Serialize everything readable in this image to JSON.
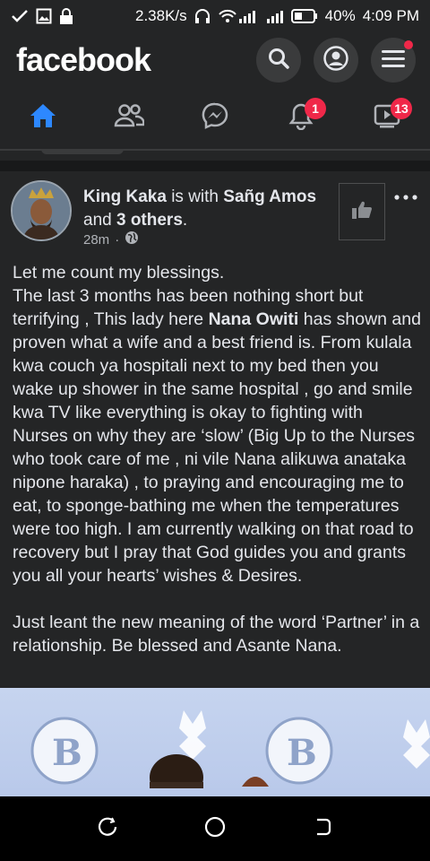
{
  "status_bar": {
    "speed": "2.38K/s",
    "battery": "40%",
    "time": "4:09 PM"
  },
  "header": {
    "brand": "facebook"
  },
  "nav": {
    "notifications_badge": "1",
    "watch_badge": "13",
    "active_tab": "home",
    "accent_color": "#2d88ff"
  },
  "post": {
    "author": "King Kaka",
    "with_text": " is with ",
    "tagged": "Sañg Amos",
    "and_text": "and ",
    "others": "3 others",
    "others_suffix": ".",
    "time": "28m",
    "dot": "·",
    "body": {
      "line1": "Let me count my blessings.",
      "p2_before": "The last 3 months has been nothing short but terrifying , This lady here ",
      "p2_name": "Nana Owiti",
      "p2_after": " has shown and proven what a wife and a best friend is. From kulala kwa couch ya hospitali next to my bed then you wake up shower in the same hospital , go and smile kwa TV like everything is okay to fighting with Nurses on why they are ‘slow’ (Big Up to the Nurses who took care of me , ni vile Nana alikuwa anataka nipone haraka) , to praying and encouraging me to eat, to sponge-bathing me when the temperatures were too high. I am currently walking on that road to recovery but I pray that God guides you and grants you all your hearts’ wishes & Desires.",
      "p3": "Just leant the new meaning of the word ‘Partner’ in a relationship. Be blessed and Asante Nana."
    }
  }
}
